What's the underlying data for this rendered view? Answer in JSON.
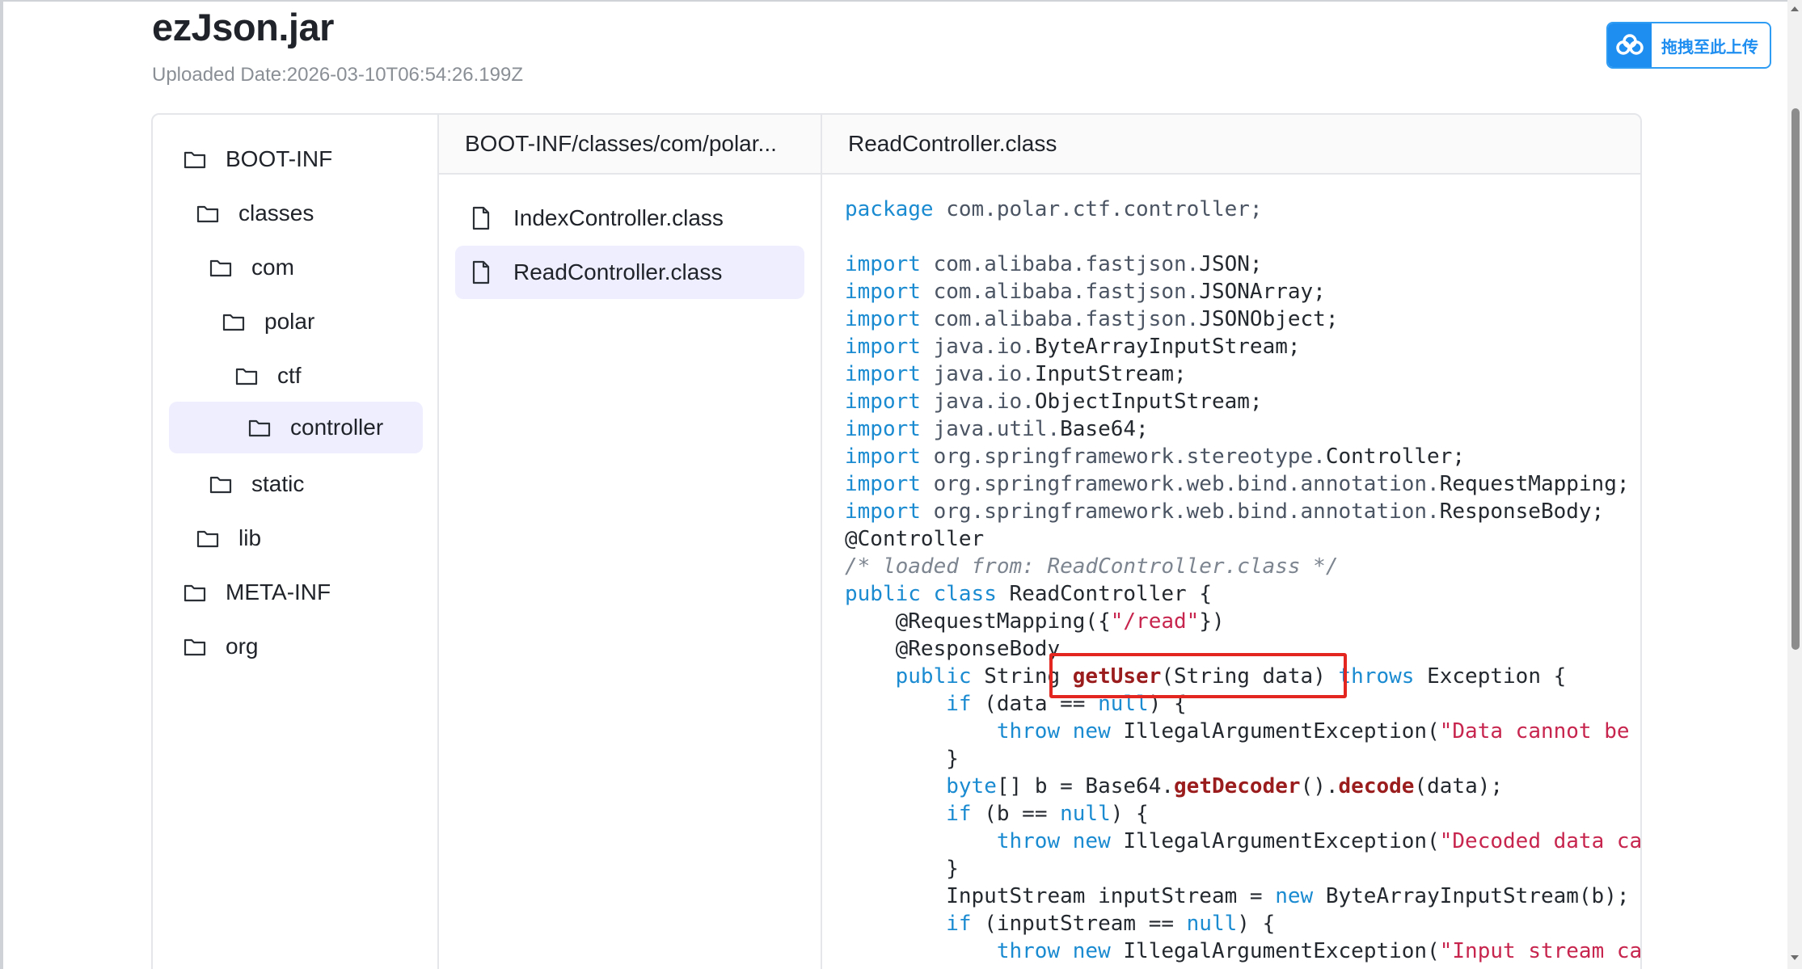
{
  "header": {
    "title": "ezJson.jar",
    "uploaded": "Uploaded Date:2026-03-10T06:54:26.199Z"
  },
  "upload_button": {
    "label": "拖拽至此上传",
    "icon": "cloud-upload-icon",
    "color": "#1f8ef1"
  },
  "tree": {
    "items": [
      {
        "label": "BOOT-INF",
        "icon": "folder-icon"
      },
      {
        "label": "classes",
        "icon": "folder-icon"
      },
      {
        "label": "com",
        "icon": "folder-icon"
      },
      {
        "label": "polar",
        "icon": "folder-icon"
      },
      {
        "label": "ctf",
        "icon": "folder-icon"
      },
      {
        "label": "controller",
        "icon": "folder-icon",
        "selected": true
      },
      {
        "label": "static",
        "icon": "folder-icon"
      },
      {
        "label": "lib",
        "icon": "folder-icon"
      },
      {
        "label": "META-INF",
        "icon": "folder-icon"
      },
      {
        "label": "org",
        "icon": "folder-icon"
      }
    ]
  },
  "files": {
    "header": "BOOT-INF/classes/com/polar...",
    "items": [
      {
        "label": "IndexController.class",
        "icon": "file-icon"
      },
      {
        "label": "ReadController.class",
        "icon": "file-icon",
        "selected": true
      }
    ]
  },
  "code": {
    "header": "ReadController.class",
    "lines": {
      "l1_kw": "package",
      "l1_rest": " com.polar.ctf.controller;",
      "imp": "import",
      "i1_pkg": " com.alibaba.fastjson.",
      "i1_cls": "JSON;",
      "i2_pkg": " com.alibaba.fastjson.",
      "i2_cls": "JSONArray;",
      "i3_pkg": " com.alibaba.fastjson.",
      "i3_cls": "JSONObject;",
      "i4_pkg": " java.io.",
      "i4_cls": "ByteArrayInputStream;",
      "i5_pkg": " java.io.",
      "i5_cls": "InputStream;",
      "i6_pkg": " java.io.",
      "i6_cls": "ObjectInputStream;",
      "i7_pkg": " java.util.",
      "i7_cls": "Base64;",
      "i8_pkg": " org.springframework.stereotype.",
      "i8_cls": "Controller;",
      "i9_pkg": " org.springframework.web.bind.annotation.",
      "i9_cls": "RequestMapping;",
      "i10_pkg": " org.springframework.web.bind.annotation.",
      "i10_cls": "ResponseBody;",
      "ann_controller": "@Controller",
      "comment": "/* loaded from: ReadController.class */",
      "public": "public",
      "class": "class",
      "class_name": " ReadController {",
      "rm_pre": "    @RequestMapping({",
      "rm_str": "\"/read\"",
      "rm_post": "})",
      "rb": "    @ResponseBody",
      "m_indent": "    ",
      "m_public": "public",
      "m_string": " String ",
      "m_name": "getUser",
      "m_params": "(String data) ",
      "m_throws": "throws",
      "m_exc": " Exception {",
      "if1_pre": "        ",
      "if": "if",
      "if1_mid": " (data == ",
      "null": "null",
      "if1_post": ") {",
      "t_indent": "            ",
      "throw": "throw",
      "new": "new",
      "iae": " IllegalArgumentException(",
      "t1_str": "\"Data cannot be null\");",
      "close1": "        }",
      "b_pre": "        ",
      "byte": "byte",
      "b_mid": "[] b = Base64.",
      "getDecoder": "getDecoder",
      "b_mid2": "().",
      "decode": "decode",
      "b_post": "(data);",
      "if2_mid": " (b == ",
      "t2_str": "\"Decoded data cannot be null\");",
      "close2": "        }",
      "is_pre": "        InputStream inputStream = ",
      "is_post": " ByteArrayInputStream(b);",
      "if3_mid": " (inputStream == ",
      "t3_str": "\"Input stream cannot be null\");"
    }
  }
}
